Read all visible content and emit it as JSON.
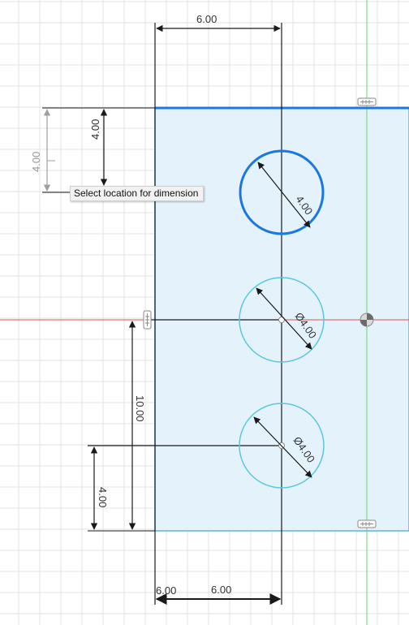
{
  "tooltip": {
    "text": "Select location for dimension"
  },
  "dimensions": {
    "top_width": "6.00",
    "left_outer": "4.00",
    "left_inner": "4.00",
    "vertical_total": "10.00",
    "vertical_bottom": "4.00",
    "bottom_left": "6.00",
    "bottom_right": "6.00",
    "hole1_diameter": "4.00",
    "hole2_diameter": "Ø4.00",
    "hole3_diameter": "Ø4.00"
  },
  "colors": {
    "background": "#ffffff",
    "grid": "#e3e3e3",
    "sketch_fill": "#e4f2fb",
    "sketch_edge": "#5bb7dc",
    "selected": "#1a78e0",
    "x_axis": "#e05050",
    "y_axis": "#6cd46c",
    "dimension_line": "#1a1a1a"
  },
  "icons": [
    "coincident-constraint-icon",
    "horizontal-constraint-icon",
    "origin-icon"
  ]
}
